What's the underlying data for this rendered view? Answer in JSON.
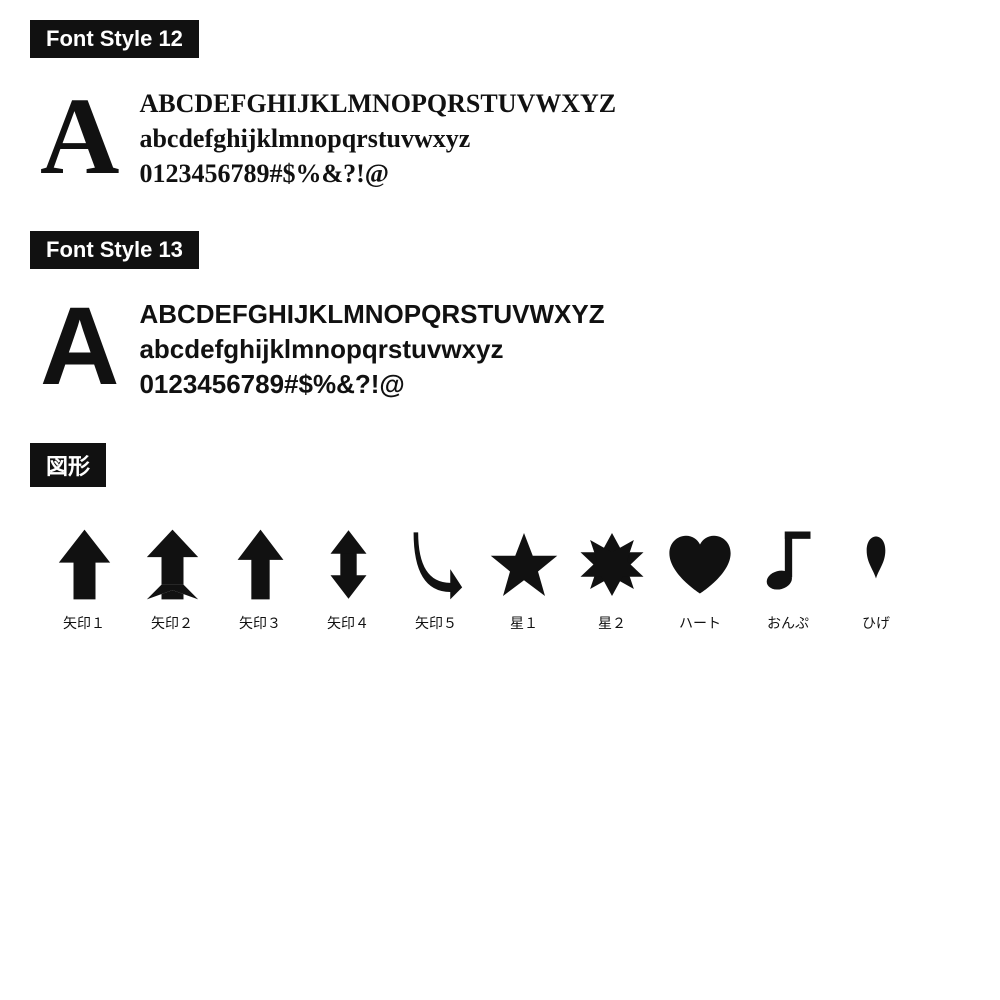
{
  "sections": [
    {
      "id": "font-style-12",
      "label": "Font Style 12",
      "fontClass": "serif",
      "lines": [
        "ABCDEFGHIJKLMNOPQRSTUVWXYZ",
        "abcdefghijklmnopqrstuvwxyz",
        "0123456789#$%&?!@"
      ]
    },
    {
      "id": "font-style-13",
      "label": "Font Style 13",
      "fontClass": "sans",
      "lines": [
        "ABCDEFGHIJKLMNOPQRSTUVWXYZ",
        "abcdefghijklmnopqrstuvwxyz",
        "0123456789#$%&?!@"
      ]
    }
  ],
  "shapes_section": {
    "label": "図形",
    "items": [
      {
        "id": "arrow1",
        "label": "矢印１"
      },
      {
        "id": "arrow2",
        "label": "矢印２"
      },
      {
        "id": "arrow3",
        "label": "矢印３"
      },
      {
        "id": "arrow4",
        "label": "矢印４"
      },
      {
        "id": "arrow5",
        "label": "矢印５"
      },
      {
        "id": "star1",
        "label": "星１"
      },
      {
        "id": "star2",
        "label": "星２"
      },
      {
        "id": "heart",
        "label": "ハート"
      },
      {
        "id": "note",
        "label": "おんぷ"
      },
      {
        "id": "mustache",
        "label": "ひげ"
      }
    ]
  }
}
